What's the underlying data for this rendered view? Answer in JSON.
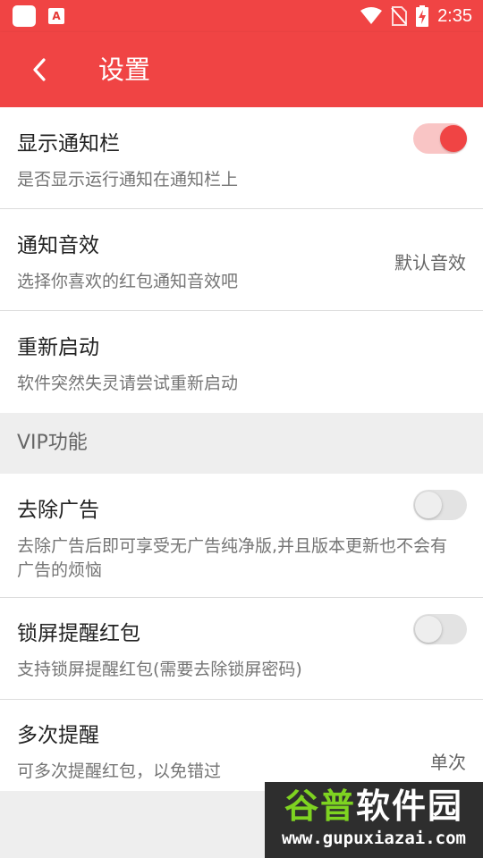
{
  "status_bar": {
    "time": "2:35",
    "icons": [
      "app-icon",
      "wifi-icon",
      "no-sim-icon",
      "battery-charging-icon"
    ]
  },
  "toolbar": {
    "title": "设置",
    "back_icon": "chevron-left-icon"
  },
  "settings": [
    {
      "title": "显示通知栏",
      "subtitle": "是否显示运行通知在通知栏上",
      "control": "switch",
      "on": true
    },
    {
      "title": "通知音效",
      "subtitle": "选择你喜欢的红包通知音效吧",
      "value": "默认音效"
    },
    {
      "title": "重新启动",
      "subtitle": "软件突然失灵请尝试重新启动"
    }
  ],
  "vip_section": {
    "header": "VIP功能",
    "items": [
      {
        "title": "去除广告",
        "subtitle": "去除广告后即可享受无广告纯净版,并且版本更新也不会有广告的烦恼",
        "control": "switch",
        "on": false
      },
      {
        "title": "锁屏提醒红包",
        "subtitle": "支持锁屏提醒红包(需要去除锁屏密码)",
        "control": "switch",
        "on": false
      },
      {
        "title": "多次提醒",
        "subtitle": "可多次提醒红包，以免错过",
        "value": "单次"
      }
    ]
  },
  "watermark": {
    "cn_part1": "谷普",
    "cn_part2": "软件园",
    "url": "www.gupuxiazai.com"
  },
  "colors": {
    "accent": "#f04444",
    "switch_on_track": "#f9c5c5",
    "background": "#eeeeee"
  }
}
